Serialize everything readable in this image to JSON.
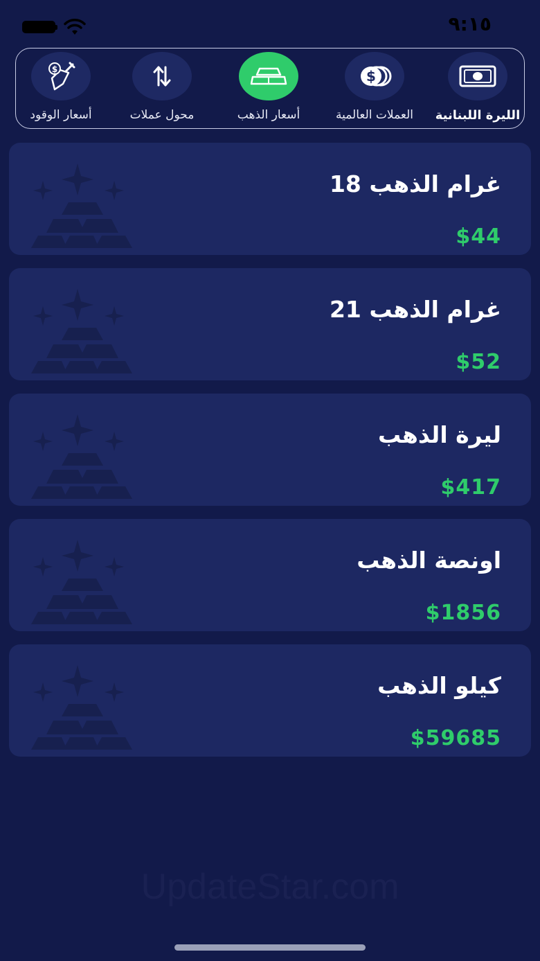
{
  "status_bar": {
    "time": "٩:١٥"
  },
  "nav": {
    "items": [
      {
        "label": "الليرة اللبنانية",
        "icon": "banknote-icon"
      },
      {
        "label": "العملات العالمية",
        "icon": "coins-icon"
      },
      {
        "label": "أسعار الذهب",
        "icon": "gold-bars-icon"
      },
      {
        "label": "محول عملات",
        "icon": "swap-arrows-icon"
      },
      {
        "label": "أسعار الوقود",
        "icon": "fuel-nozzle-icon"
      }
    ],
    "active_index": 2
  },
  "cards": [
    {
      "title": "غرام الذهب 18",
      "price": "$44"
    },
    {
      "title": "غرام الذهب 21",
      "price": "$52"
    },
    {
      "title": "ليرة الذهب",
      "price": "$417"
    },
    {
      "title": "اونصة الذهب",
      "price": "$1856"
    },
    {
      "title": "كيلو الذهب",
      "price": "$59685"
    }
  ],
  "watermark": "UpdateStar.com",
  "colors": {
    "background": "#121a4a",
    "card": "#1d2862",
    "accent_green": "#2fcc6b"
  }
}
